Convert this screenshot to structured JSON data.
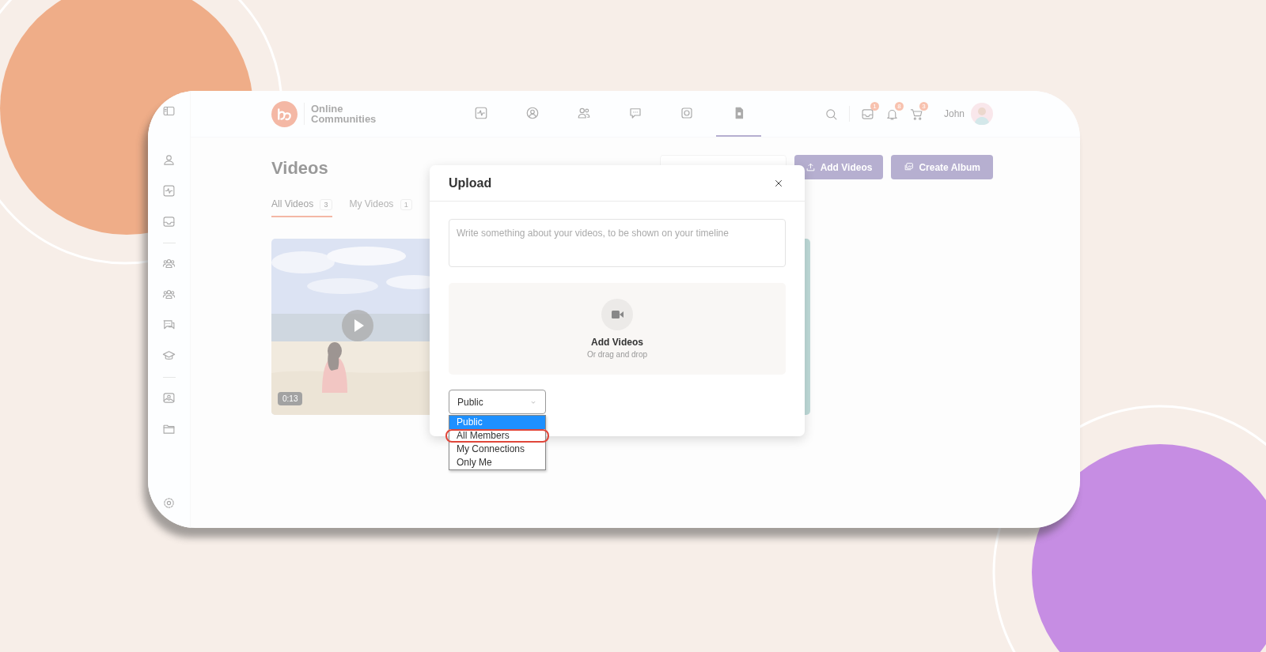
{
  "brand": {
    "line1": "Online",
    "line2": "Communities"
  },
  "top_nav": [
    {
      "selected": false
    },
    {
      "selected": false
    },
    {
      "selected": false
    },
    {
      "selected": false
    },
    {
      "selected": false
    },
    {
      "selected": true
    }
  ],
  "header_counts": [
    {
      "count": "1"
    },
    {
      "count": "8"
    },
    {
      "count": "3"
    }
  ],
  "user": {
    "name": "John"
  },
  "page_title": "Videos",
  "tabs": [
    {
      "label": "All Videos",
      "count": "3",
      "selected": true
    },
    {
      "label": "My Videos",
      "count": "1",
      "selected": false
    }
  ],
  "buttons": [
    "Add Videos",
    "Create Album"
  ],
  "videos": [
    {
      "kind": "picture",
      "duration": "0:13"
    }
  ],
  "modal": {
    "title": "Upload",
    "composer": {
      "placeholder": "Write something about your videos, to be shown on your timeline"
    },
    "dropzone": {
      "title": "Add Videos",
      "subtitle": "Or drag and drop"
    },
    "privacy": {
      "value": "Public",
      "options": [
        {
          "label": "Public",
          "selected": true,
          "annotated": false
        },
        {
          "label": "All Members",
          "selected": false,
          "annotated": true
        },
        {
          "label": "My Connections",
          "selected": false,
          "annotated": false
        },
        {
          "label": "Only Me",
          "selected": false,
          "annotated": false
        }
      ]
    }
  }
}
